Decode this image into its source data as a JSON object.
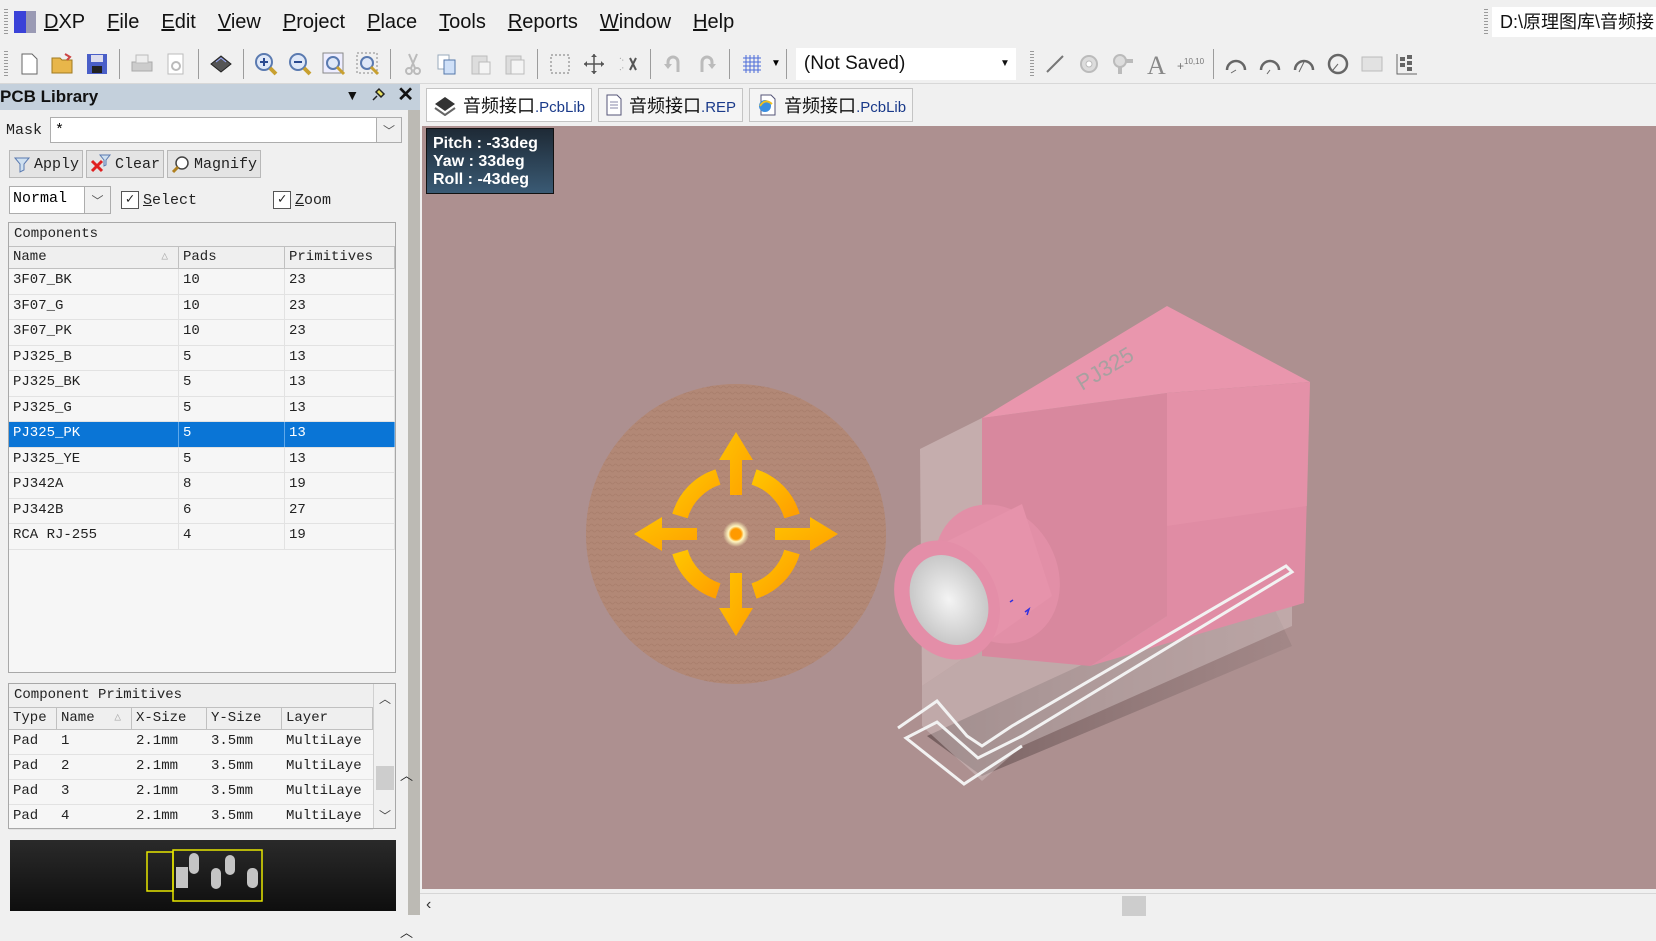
{
  "menubar": {
    "app_name": "DXP",
    "items": [
      "File",
      "Edit",
      "View",
      "Project",
      "Place",
      "Tools",
      "Reports",
      "Window",
      "Help"
    ],
    "path": "D:\\原理图库\\音频接口"
  },
  "toolbar": {
    "buttons": [
      "new-document",
      "open",
      "save",
      "print",
      "print-preview",
      "layer-stack",
      "zoom-in",
      "zoom-out",
      "zoom-fit",
      "zoom-area",
      "cut",
      "copy",
      "paste",
      "paste-special",
      "select-area",
      "move",
      "cross-select",
      "undo",
      "redo",
      "grid"
    ],
    "snap_select_value": "(Not Saved)",
    "place_tools": [
      "place-line",
      "place-pad",
      "place-via",
      "place-string",
      "place-coordinate",
      "arc-center",
      "arc-edge",
      "arc-any",
      "full-circle",
      "fill",
      "array-paste"
    ]
  },
  "panel": {
    "title": "PCB Library",
    "mask_label": "Mask",
    "mask_value": "*",
    "apply_label": "Apply",
    "clear_label": "Clear",
    "magnify_label": "Magnify",
    "mode_value": "Normal",
    "select_label": "Select",
    "select_checked": true,
    "zoom_label": "Zoom",
    "zoom_checked": true,
    "components": {
      "title": "Components",
      "columns": [
        "Name",
        "Pads",
        "Primitives"
      ],
      "rows": [
        {
          "name": "3F07_BK",
          "pads": "10",
          "primitives": "23"
        },
        {
          "name": "3F07_G",
          "pads": "10",
          "primitives": "23"
        },
        {
          "name": "3F07_PK",
          "pads": "10",
          "primitives": "23"
        },
        {
          "name": "PJ325_B",
          "pads": "5",
          "primitives": "13"
        },
        {
          "name": "PJ325_BK",
          "pads": "5",
          "primitives": "13"
        },
        {
          "name": "PJ325_G",
          "pads": "5",
          "primitives": "13"
        },
        {
          "name": "PJ325_PK",
          "pads": "5",
          "primitives": "13"
        },
        {
          "name": "PJ325_YE",
          "pads": "5",
          "primitives": "13"
        },
        {
          "name": "PJ342A",
          "pads": "8",
          "primitives": "19"
        },
        {
          "name": "PJ342B",
          "pads": "6",
          "primitives": "27"
        },
        {
          "name": "RCA RJ-255",
          "pads": "4",
          "primitives": "19"
        }
      ],
      "selected_index": 6
    },
    "primitives": {
      "title": "Component Primitives",
      "columns": [
        "Type",
        "Name",
        "X-Size",
        "Y-Size",
        "Layer"
      ],
      "rows": [
        {
          "type": "Pad",
          "name": "1",
          "x": "2.1mm",
          "y": "3.5mm",
          "layer": "MultiLaye"
        },
        {
          "type": "Pad",
          "name": "2",
          "x": "2.1mm",
          "y": "3.5mm",
          "layer": "MultiLaye"
        },
        {
          "type": "Pad",
          "name": "3",
          "x": "2.1mm",
          "y": "3.5mm",
          "layer": "MultiLaye"
        },
        {
          "type": "Pad",
          "name": "4",
          "x": "2.1mm",
          "y": "3.5mm",
          "layer": "MultiLaye"
        }
      ]
    }
  },
  "tabs": [
    {
      "name": "音频接口",
      "ext": ".PcbLib",
      "icon": "pcb-library-icon",
      "active": true
    },
    {
      "name": "音频接口",
      "ext": ".REP",
      "icon": "report-document-icon",
      "active": false
    },
    {
      "name": "音频接口",
      "ext": ".PcbLib",
      "icon": "browser-document-icon",
      "active": false
    }
  ],
  "viewport": {
    "pitch": "Pitch : -33deg",
    "yaw": "Yaw : 33deg",
    "roll": "Roll : -43deg",
    "model_label": "PJ325",
    "background_color": "#ad9090",
    "body_color": "#e996ad"
  }
}
